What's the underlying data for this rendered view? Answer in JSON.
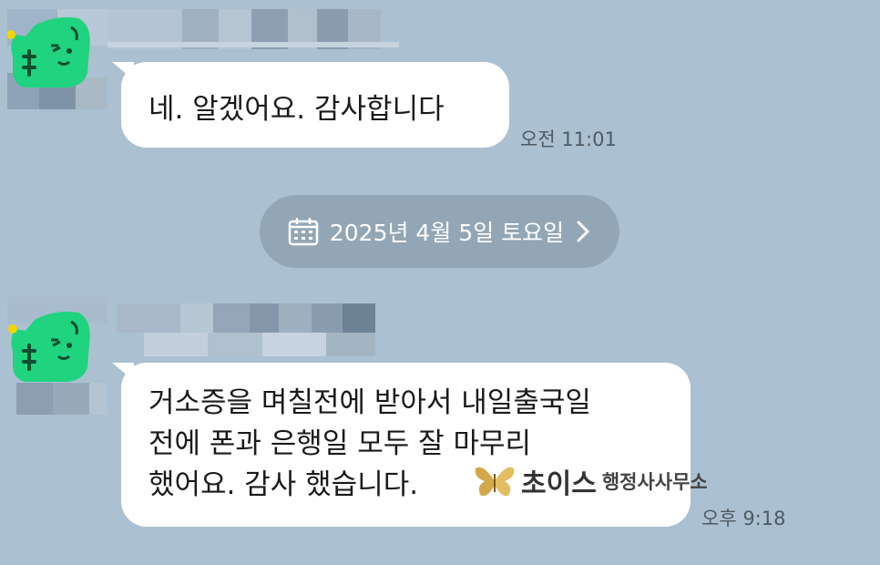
{
  "messages": [
    {
      "text": "네. 알겠어요. 감사합니다",
      "time": "오전 11:01"
    },
    {
      "lines": [
        "거소증을 며칠전에 받아서 내일출국일",
        "전에 폰과 은행일 모두 잘 마무리",
        "했어요.  감사 했습니다."
      ],
      "time": "오후 9:18"
    }
  ],
  "date_divider": {
    "label": "2025년 4월 5일 토요일",
    "icon": "calendar-icon",
    "chevron": "chevron-right-icon"
  },
  "watermark": {
    "brand": "초이스",
    "sub": "행정사사무소",
    "logo": "butterfly-logo"
  },
  "colors": {
    "background": "#abc1d1",
    "bubble": "#ffffff",
    "date_pill": "#93a6b5",
    "avatar_green": "#1fd37f"
  }
}
